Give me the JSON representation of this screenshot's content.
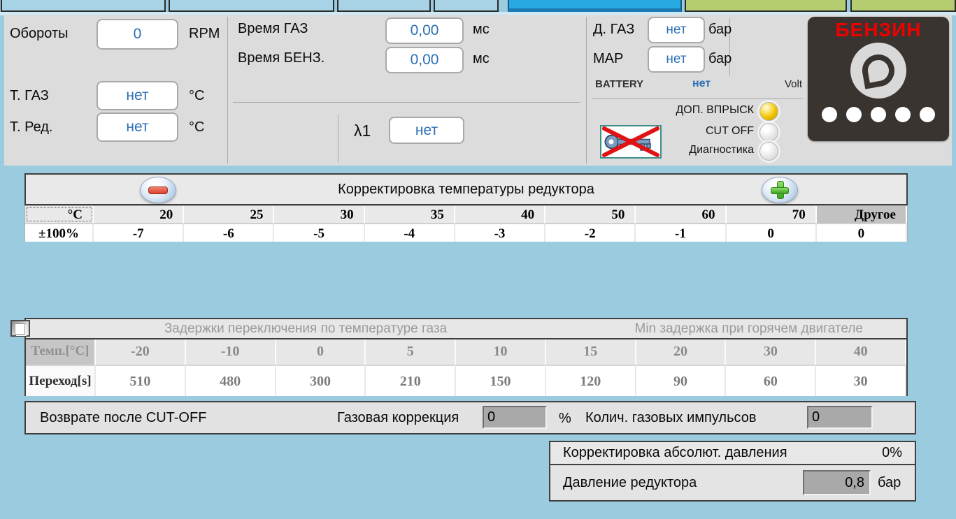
{
  "colors": {
    "page_background": "#9bcbdf",
    "panel_gray": "#dcdcdc",
    "tab_active_blue": "#29a9e1",
    "tab_inactive_blue": "#a8d2e6",
    "tab_green": "#b6cc70",
    "value_text_blue": "#2c70b5",
    "fuel_badge_text_red": "#ee0000",
    "led_on_yellow": "#f2c500",
    "minus_button_red": "#d8402e",
    "plus_button_green": "#4fc32d"
  },
  "top_panel": {
    "rpm": {
      "label": "Обороты",
      "value": "0",
      "unit": "RPM"
    },
    "time_gas": {
      "label": "Время ГАЗ",
      "value": "0,00",
      "unit": "мс"
    },
    "time_benz": {
      "label": "Время БЕНЗ.",
      "value": "0,00",
      "unit": "мс"
    },
    "t_gas": {
      "label": "Т. ГАЗ",
      "value": "нет",
      "unit": "°C"
    },
    "t_red": {
      "label": "Т. Ред.",
      "value": "нет",
      "unit": "°C"
    },
    "lambda1": {
      "label": "λ1",
      "value": "нет"
    },
    "d_gas": {
      "label": "Д. ГАЗ",
      "value": "нет",
      "unit": "бар"
    },
    "map": {
      "label": "MAP",
      "value": "нет",
      "unit": "бар"
    },
    "battery": {
      "label": "BATTERY",
      "value": "нет",
      "unit": "Volt"
    },
    "indicators": [
      {
        "label": "ДОП. ВПРЫСК",
        "state": "on"
      },
      {
        "label": "CUT OFF",
        "state": "off"
      },
      {
        "label": "Диагностика",
        "state": "off"
      }
    ],
    "fuel_badge": {
      "label": "БЕНЗИН",
      "dots": 5
    }
  },
  "reducer_temp_correction": {
    "title": "Корректировка температуры редуктора",
    "header": [
      "°C",
      "20",
      "25",
      "30",
      "35",
      "40",
      "50",
      "60",
      "70",
      "Другое"
    ],
    "values": [
      "±100%",
      "-7",
      "-6",
      "-5",
      "-4",
      "-3",
      "-2",
      "-1",
      "0",
      "0"
    ]
  },
  "switch_delays": {
    "title_left": "Задержки переключения по температуре газа",
    "title_right": "Min задержка при горячем двигателе",
    "checkbox_checked": false,
    "header": [
      "Темп.[°C]",
      "-20",
      "-10",
      "0",
      "5",
      "10",
      "15",
      "20",
      "30",
      "40"
    ],
    "values": [
      "Переход[s]",
      "510",
      "480",
      "300",
      "210",
      "150",
      "120",
      "90",
      "60",
      "30"
    ]
  },
  "cutoff_panel": {
    "label": "Возврате после CUT-OFF",
    "gas_correction_label": "Газовая коррекция",
    "gas_correction_value": "0",
    "gas_correction_unit": "%",
    "gas_pulses_label": "Колич. газовых импульсов",
    "gas_pulses_value": "0"
  },
  "pressure_panel": {
    "abs_correction_label": "Корректировка абсолют. давления",
    "abs_correction_value": "0%",
    "reducer_pressure_label": "Давление редуктора",
    "reducer_pressure_value": "0,8",
    "reducer_pressure_unit": "бар"
  }
}
